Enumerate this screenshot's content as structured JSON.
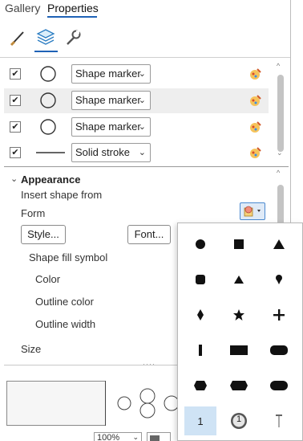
{
  "tabs": [
    {
      "label": "Gallery",
      "active": false
    },
    {
      "label": "Properties",
      "active": true
    }
  ],
  "toolbar_icons": [
    "brush-icon",
    "layers-icon",
    "wrench-icon"
  ],
  "layers": [
    {
      "checked": true,
      "symbol": "circle",
      "type": "Shape marker",
      "selected": false
    },
    {
      "checked": true,
      "symbol": "circle",
      "type": "Shape marker",
      "selected": true
    },
    {
      "checked": true,
      "symbol": "circle",
      "type": "Shape marker",
      "selected": false
    },
    {
      "checked": true,
      "symbol": "line",
      "type": "Solid stroke",
      "selected": false
    }
  ],
  "appearance": {
    "title": "Appearance",
    "insert_shape_from": "Insert shape from",
    "form": "Form",
    "style_button": "Style...",
    "font_button": "Font...",
    "shape_fill_symbol": "Shape fill symbol",
    "color": "Color",
    "outline_color": "Outline color",
    "outline_width": "Outline width",
    "size": "Size"
  },
  "shape_picker": {
    "selected_index": 15,
    "shapes": [
      "circle",
      "square",
      "triangle",
      "rounded-square",
      "triangle-small",
      "pin",
      "diamond",
      "star",
      "plus",
      "vertical-bar",
      "rectangle",
      "rounded-rectangle",
      "hexagon",
      "long-hexagon",
      "pill",
      "numbered-square",
      "numbered-circle",
      "pole"
    ],
    "numbered_label": "1"
  },
  "footer": {
    "zoom": "100%"
  },
  "colors": {
    "accent": "#1f62b6",
    "selection": "#cfe3f5"
  }
}
